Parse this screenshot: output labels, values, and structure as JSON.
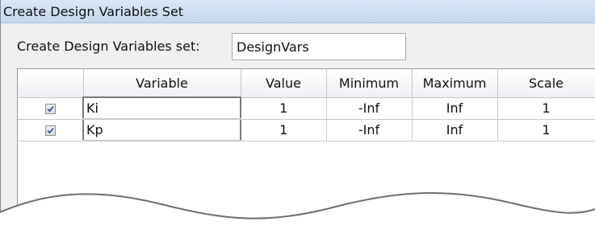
{
  "window": {
    "title": "Create Design Variables Set"
  },
  "form": {
    "name_label": "Create Design Variables set:",
    "name_value": "DesignVars"
  },
  "table": {
    "headers": [
      "",
      "Variable",
      "Value",
      "Minimum",
      "Maximum",
      "Scale"
    ],
    "rows": [
      {
        "checked": true,
        "variable": "Ki",
        "value": "1",
        "minimum": "-Inf",
        "maximum": "Inf",
        "scale": "1"
      },
      {
        "checked": true,
        "variable": "Kp",
        "value": "1",
        "minimum": "-Inf",
        "maximum": "Inf",
        "scale": "1"
      }
    ]
  },
  "colors": {
    "titlebar": "#c4d8ef",
    "dialog_bg": "#f0f0f0",
    "checkmark": "#2b5fa8"
  },
  "icons": {
    "checkbox": "checkmark-icon"
  }
}
